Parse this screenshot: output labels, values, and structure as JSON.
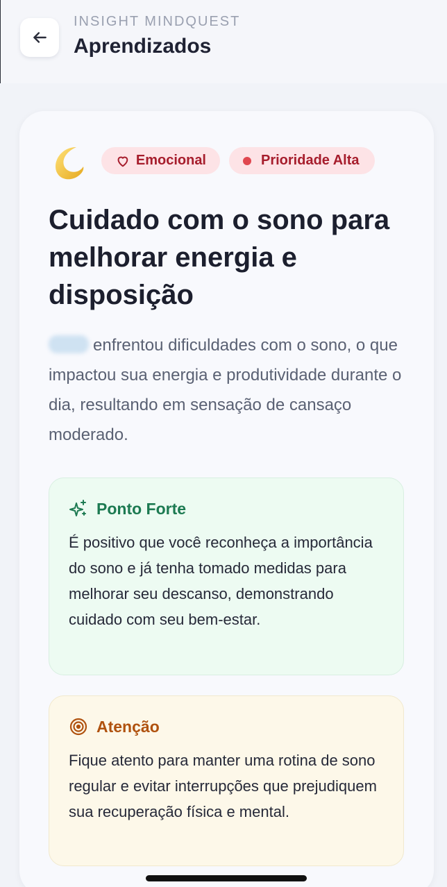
{
  "header": {
    "brand": "INSIGHT MINDQUEST",
    "title": "Aprendizados"
  },
  "card": {
    "emoji": "🌙",
    "tags": [
      {
        "label": "Emocional",
        "icon": "heart-outline-icon"
      },
      {
        "label": "Prioridade Alta",
        "icon": "red-dot-icon"
      }
    ],
    "headline": "Cuidado com o sono para melhorar energia e disposição",
    "description": "enfrentou dificuldades com o sono, o que impactou sua energia e produtividade durante o dia, resultando em sensação de cansaço moderado.",
    "strong_point": {
      "title": "Ponto Forte",
      "icon": "sparkles-icon",
      "text": "É positivo que você reconheça a importância do sono e já tenha tomado medidas para melhorar seu descanso, demonstrando cuidado com seu bem-estar."
    },
    "attention": {
      "title": "Atenção",
      "icon": "target-icon",
      "text": "Fique atento para manter uma rotina de sono regular e evitar interrupções que prejudiquem sua recuperação física e mental."
    }
  },
  "colors": {
    "tag_bg": "#fde3e6",
    "tag_text": "#a61d2c",
    "strong_bg": "#edfbf2",
    "strong_accent": "#1d7a52",
    "attention_bg": "#fdf8e9",
    "attention_accent": "#b0520f"
  }
}
